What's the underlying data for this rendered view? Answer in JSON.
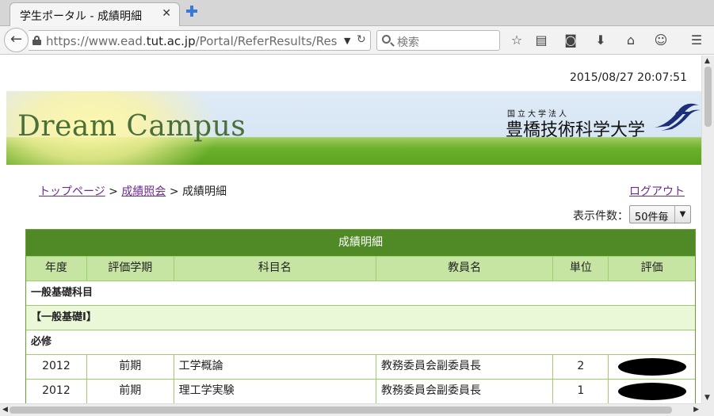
{
  "browser": {
    "tab_title": "学生ポータル - 成績明細",
    "tab_close": "✕",
    "url_prefix": "https://www.ead.",
    "url_domain": "tut.ac.jp",
    "url_path": "/Portal/ReferResults/Res",
    "search_placeholder": "検索"
  },
  "page": {
    "datetime": "2015/08/27 20:07:51",
    "banner": {
      "title": "Dream Campus",
      "sub": "国立大学法人",
      "university": "豊橋技術科学大学"
    },
    "breadcrumb": {
      "home": "トップページ",
      "sep1": " > ",
      "grades_inquiry": "成績照会",
      "sep2": " > ",
      "current": "成績明細"
    },
    "logout": "ログアウト",
    "per_page": {
      "label": "表示件数：",
      "value": "50件毎"
    },
    "table": {
      "caption": "成績明細",
      "headers": [
        "年度",
        "評価学期",
        "科目名",
        "教員名",
        "単位",
        "評価"
      ],
      "groups": [
        "一般基礎科目",
        "【一般基礎I】",
        "必修"
      ],
      "rows": [
        {
          "year": "2012",
          "term": "前期",
          "subject": "工学概論",
          "teacher": "教務委員会副委員長",
          "units": "2"
        },
        {
          "year": "2012",
          "term": "前期",
          "subject": "理工学実験",
          "teacher": "教務委員会副委員長",
          "units": "1"
        }
      ]
    }
  }
}
